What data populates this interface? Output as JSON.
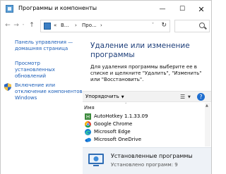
{
  "window": {
    "title": "Программы и компоненты"
  },
  "titlebar_buttons": {
    "minimize": "—",
    "maximize": "☐",
    "close": "✕"
  },
  "address": {
    "crumbs": [
      "«",
      "В...",
      "›",
      "Про...",
      "›"
    ],
    "search_placeholder": ""
  },
  "sidebar": {
    "items": [
      {
        "label": "Панель управления — домашняя страница"
      },
      {
        "label": "Просмотр установленных обновлений"
      },
      {
        "label": "Включение или отключение компонентов Windows"
      }
    ]
  },
  "main": {
    "heading": "Удаление или изменение программы",
    "description": "Для удаления программы выберите ее в списке и щелкните \"Удалить\", \"Изменить\" или \"Восстановить\"."
  },
  "toolbar": {
    "organize_label": "Упорядочить",
    "help_label": "?"
  },
  "list": {
    "column_header": "Имя",
    "items": [
      {
        "name": "AutoHotkey 1.1.33.09",
        "icon": "autohotkey-icon"
      },
      {
        "name": "Google Chrome",
        "icon": "chrome-icon"
      },
      {
        "name": "Microsoft Edge",
        "icon": "edge-icon"
      },
      {
        "name": "Microsoft OneDrive",
        "icon": "onedrive-icon"
      }
    ]
  },
  "status": {
    "title": "Установленные программы",
    "count": "Установлено программ: 9"
  },
  "colors": {
    "link": "#1a5db8",
    "heading": "#1e3f7a",
    "status_bg": "#eef2f7"
  }
}
